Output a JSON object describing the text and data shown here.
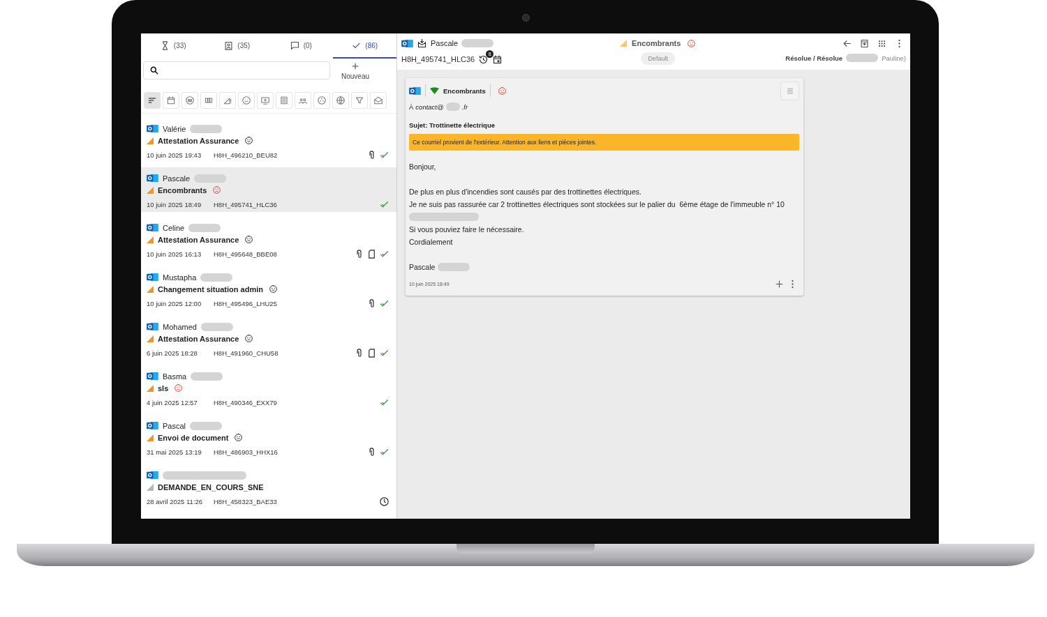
{
  "tabs": [
    {
      "count": "(33)",
      "selected": false
    },
    {
      "count": "(35)",
      "selected": false
    },
    {
      "count": "(0)",
      "selected": false
    },
    {
      "count": "(86)",
      "selected": true
    }
  ],
  "new_button": {
    "label": "Nouveau"
  },
  "filters": [
    {
      "selected": true
    },
    {
      "selected": false
    },
    {
      "selected": false
    },
    {
      "selected": false
    },
    {
      "selected": false
    },
    {
      "selected": false
    },
    {
      "selected": false
    },
    {
      "selected": false
    },
    {
      "selected": false
    },
    {
      "selected": false
    },
    {
      "selected": false
    },
    {
      "selected": false
    },
    {
      "selected": false
    }
  ],
  "conversations": [
    {
      "sender": "Valérie",
      "color": "#f7941d",
      "subject": "Attestation Assurance",
      "mood": {
        "unhappy": false
      },
      "date": "10 juin 2025 19:43",
      "reference": "H8H_496210_BEU82",
      "attachment": true,
      "document": false,
      "resolved": true,
      "selected": false
    },
    {
      "sender": "Pascale",
      "color": "#f7941d",
      "subject": "Encombrants",
      "mood": {
        "unhappy": true
      },
      "date": "10 juin 2025 18:49",
      "reference": "H8H_495741_HLC36",
      "attachment": false,
      "document": false,
      "resolved": true,
      "selected": true
    },
    {
      "sender": "Celine",
      "color": "#f7941d",
      "subject": "Attestation Assurance",
      "mood": {
        "unhappy": false
      },
      "date": "10 juin 2025 16:13",
      "reference": "H8H_495648_BBE08",
      "attachment": true,
      "document": true,
      "resolved": true,
      "selected": false
    },
    {
      "sender": "Mustapha",
      "color": "#f7941d",
      "subject": "Changement situation admin",
      "mood": {
        "unhappy": false
      },
      "date": "10 juin 2025 12:00",
      "reference": "H8H_495496_LHU25",
      "attachment": true,
      "document": false,
      "resolved": true,
      "selected": false
    },
    {
      "sender": "Mohamed",
      "color": "#f7941d",
      "subject": "Attestation Assurance",
      "mood": {
        "unhappy": false
      },
      "date": "6 juin 2025 18:28",
      "reference": "H8H_491960_CHU58",
      "attachment": true,
      "document": true,
      "resolved": true,
      "selected": false
    },
    {
      "sender": "Basma",
      "color": "#f7941d",
      "subject": "sls",
      "mood": {
        "unhappy": true
      },
      "date": "4 juin 2025 12:57",
      "reference": "H8H_490346_EXX79",
      "attachment": false,
      "document": false,
      "resolved": true,
      "selected": false
    },
    {
      "sender": "Pascal",
      "color": "#f7941d",
      "subject": "Envoi de document",
      "mood": {
        "unhappy": false
      },
      "date": "31 mai 2025 13:19",
      "reference": "H8H_486903_HHX16",
      "attachment": true,
      "document": false,
      "resolved": true,
      "selected": false
    },
    {
      "color": "#b5b5b5",
      "subject": "DEMANDE_EN_COURS_SNE",
      "date": "28 avril 2025 11:26",
      "reference": "H8H_458323_BAE33",
      "attachment": false,
      "document": false,
      "resolved": false,
      "selected": false
    }
  ],
  "detail": {
    "sender": "Pascale",
    "reference": "H8H_495741_HLC36",
    "history_count": "8",
    "category": "Encombrants",
    "unhappy": true,
    "queue": "Default",
    "status": "Résolue / Résolue",
    "assignee": "Pauline)"
  },
  "message": {
    "category": "Encombrants",
    "unhappy": true,
    "to_label": "À",
    "to_start": "contact@",
    "to_end": ".fr",
    "subject": "Sujet: Trottinette électrique",
    "warning": "Ce courriel provient de l'extérieur. Attention aux liens et pièces jointes.",
    "body": [
      {
        "lines": [
          {
            "kind": "text",
            "text": "Bonjour,"
          }
        ]
      },
      {
        "lines": [
          {
            "kind": "text",
            "text": "De plus en plus d'incendies sont causés par des trottinettes électriques."
          },
          {
            "kind": "text",
            "text": "Je ne suis pas rassurée car 2 trottinettes électriques sont stockées sur le palier du  6ème étage de l'immeuble n° 10"
          },
          {
            "kind": "redacted"
          },
          {
            "kind": "text",
            "text": "Si vous pouviez faire le nécessaire."
          },
          {
            "kind": "text",
            "text": "Cordialement"
          }
        ]
      },
      {
        "lines": [
          {
            "kind": "text",
            "text": "Pascale"
          }
        ]
      }
    ],
    "date": "10 juin 2025 18:49"
  }
}
